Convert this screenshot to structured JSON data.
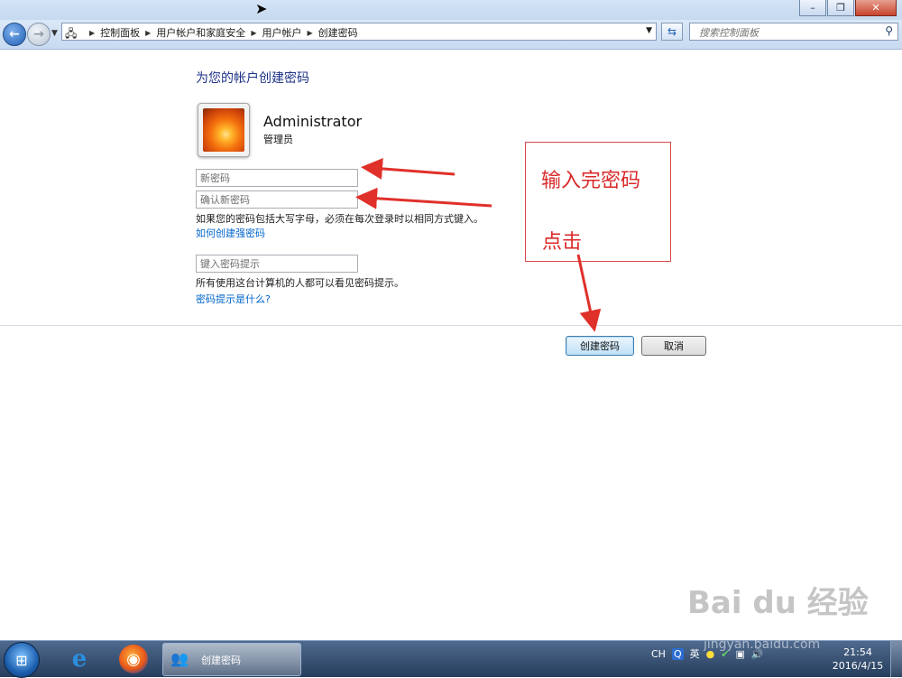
{
  "window": {
    "controls": {
      "minimize": "–",
      "maximize": "❐",
      "close": "✕"
    }
  },
  "navigation": {
    "breadcrumbs": [
      "控制面板",
      "用户帐户和家庭安全",
      "用户帐户",
      "创建密码"
    ],
    "search_placeholder": "搜索控制面板"
  },
  "page": {
    "title": "为您的帐户创建密码",
    "user": {
      "name": "Administrator",
      "role": "管理员"
    },
    "new_password_placeholder": "新密码",
    "confirm_password_placeholder": "确认新密码",
    "case_hint": "如果您的密码包括大写字母，必须在每次登录时以相同方式键入。",
    "strong_password_link": "如何创建强密码",
    "password_hint_placeholder": "键入密码提示",
    "hint_visibility_text": "所有使用这台计算机的人都可以看见密码提示。",
    "what_is_hint_link": "密码提示是什么?",
    "create_button": "创建密码",
    "cancel_button": "取消"
  },
  "annotation": {
    "line1": "输入完密码",
    "line2": "点击",
    "color": "#d92a2a"
  },
  "taskbar": {
    "task_label": "创建密码",
    "tray": {
      "lang": "CH",
      "ime": "英"
    },
    "clock": {
      "time": "21:54",
      "date": "2016/4/15"
    }
  },
  "watermark": {
    "brand": "Bai du 经验",
    "url": "jingyan.baidu.com"
  }
}
